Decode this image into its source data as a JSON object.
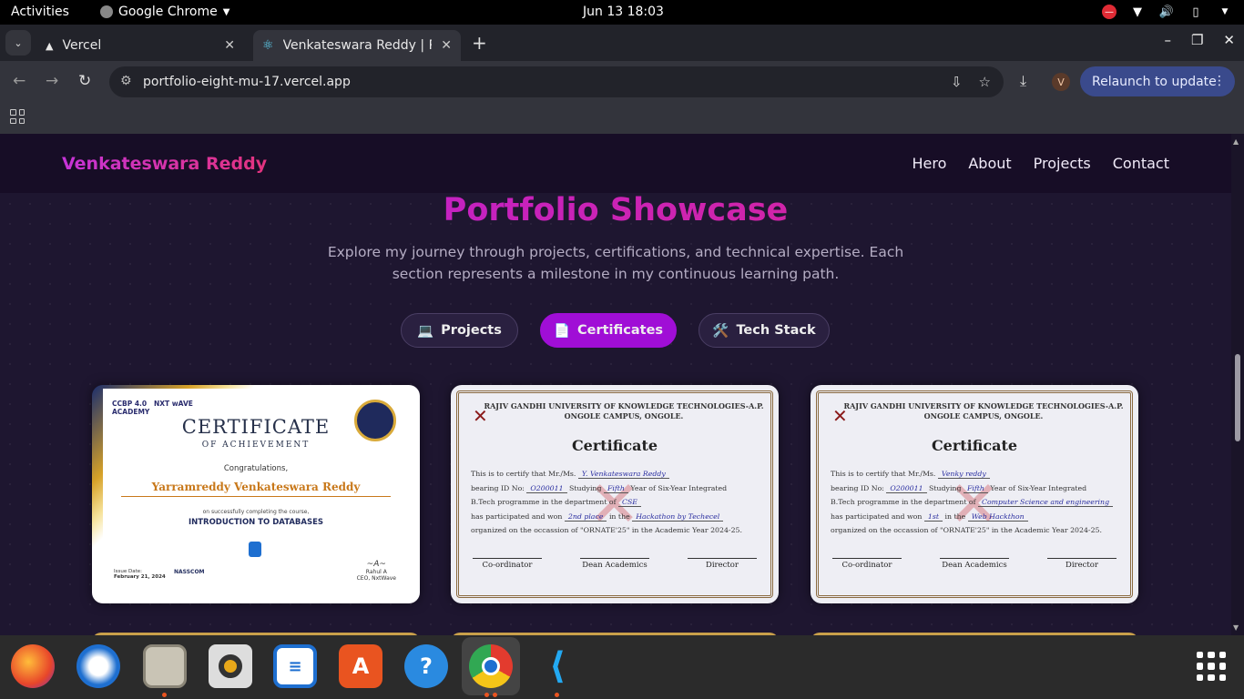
{
  "system": {
    "activities": "Activities",
    "app_name": "Google Chrome",
    "clock": "Jun 13  18:03"
  },
  "browser": {
    "tabs": [
      {
        "title": "Vercel",
        "icon": "vercel-triangle-icon"
      },
      {
        "title": "Venkateswara Reddy | Po",
        "icon": "react-icon"
      }
    ],
    "url": "portfolio-eight-mu-17.vercel.app",
    "profile_initial": "V",
    "relaunch_label": "Relaunch to update"
  },
  "site": {
    "brand": "Venkateswara Reddy",
    "nav": [
      "Hero",
      "About",
      "Projects",
      "Contact"
    ],
    "heading": "Portfolio Showcase",
    "subtitle": "Explore my journey through projects, certifications, and technical expertise. Each section represents a milestone in my continuous learning path.",
    "tabs": [
      {
        "icon": "💻",
        "label": "Projects",
        "active": false
      },
      {
        "icon": "📄",
        "label": "Certificates",
        "active": true
      },
      {
        "icon": "🛠️",
        "label": "Tech Stack",
        "active": false
      }
    ]
  },
  "certificates": {
    "nasscom": {
      "logo_line1": "CCBP 4.0",
      "logo_line2": "ACADEMY",
      "logo_nxt": "NXT wAVE",
      "title": "CERTIFICATE",
      "subtitle": "OF ACHIEVEMENT",
      "congrats": "Congratulations,",
      "name": "Yarramreddy Venkateswara Reddy",
      "completion": "on successfully completing the course,",
      "course": "INTRODUCTION TO DATABASES",
      "issue_label": "Issue Date:",
      "issue_date": "February 21, 2024",
      "signer": "Rahul A",
      "signer_role": "CEO, NxtWave",
      "member": "NASSCOM"
    },
    "rgukt_1": {
      "university": "RAJIV GANDHI UNIVERSITY OF KNOWLEDGE TECHNOLOGIES-A.P.",
      "campus": "ONGOLE CAMPUS, ONGOLE.",
      "title": "Certificate",
      "line1": "This is to certify that Mr./Ms.",
      "name": "Y. Venkateswara Reddy",
      "line2": "bearing ID No:",
      "id": "O200011",
      "studying": "Studying",
      "year": "Fifth",
      "line2b": "Year of Six-Year Integrated",
      "line3": "B.Tech programme in the department of",
      "dept": "CSE",
      "line4": "has participated and won",
      "place": "2nd place",
      "inthe": "in the",
      "event": "Hackathon by Techecel",
      "line5": "organized on the occassion of \"ORNATE'25\" in the Academic Year 2024-25.",
      "sig1": "Co-ordinator",
      "sig2": "Dean Academics",
      "sig3": "Director"
    },
    "rgukt_2": {
      "university": "RAJIV GANDHI UNIVERSITY OF KNOWLEDGE TECHNOLOGIES-A.P.",
      "campus": "ONGOLE CAMPUS, ONGOLE.",
      "title": "Certificate",
      "line1": "This is to certify that Mr./Ms.",
      "name": "Venky reddy",
      "line2": "bearing ID No:",
      "id": "O200011",
      "studying": "Studying",
      "year": "Fifth",
      "line2b": "Year of Six-Year Integrated",
      "line3": "B.Tech programme in the department of",
      "dept": "Computer Science and engineering",
      "line4": "has participated and won",
      "place": "1st",
      "inthe": "in the",
      "event": "Web Hackthon",
      "line5": "organized on the occassion of \"ORNATE'25\" in the Academic Year 2024-25.",
      "sig1": "Co-ordinator",
      "sig2": "Dean Academics",
      "sig3": "Director"
    }
  },
  "dock": [
    "firefox-icon",
    "thunderbird-icon",
    "files-icon",
    "rhythmbox-icon",
    "writer-icon",
    "app-center-icon",
    "help-icon",
    "chrome-icon",
    "vscode-icon"
  ],
  "colors": {
    "brand_gradient_start": "#c633d8",
    "brand_gradient_end": "#e4337e",
    "active_pill": "#a00ed6",
    "page_bg": "#1e1630"
  }
}
